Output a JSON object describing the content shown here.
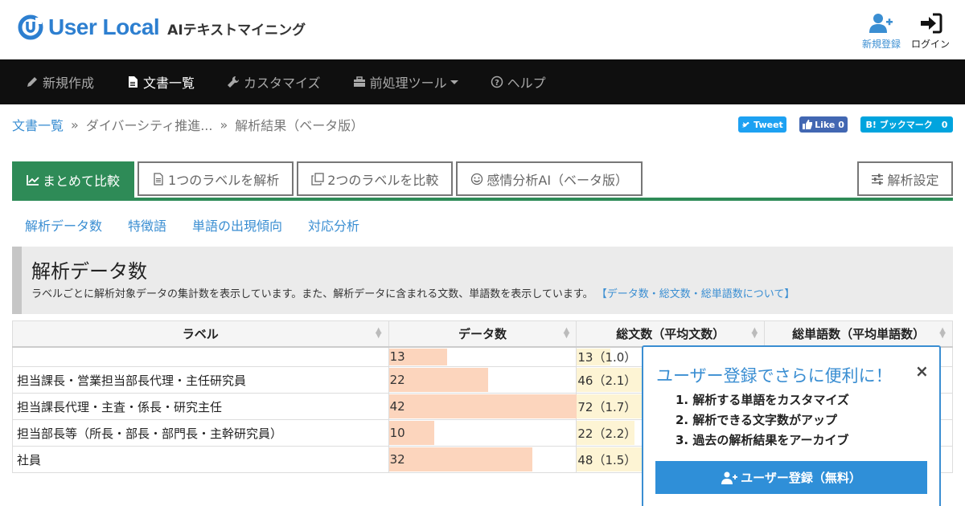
{
  "header": {
    "logo_text": "User Local",
    "logo_sub": "AIテキストマイニング",
    "register_label": "新規登録",
    "login_label": "ログイン",
    "brand_color": "#2d7fd0"
  },
  "nav": {
    "items": [
      {
        "label": "新規作成",
        "icon": "pencil-icon"
      },
      {
        "label": "文書一覧",
        "icon": "document-icon"
      },
      {
        "label": "カスタマイズ",
        "icon": "wrench-icon"
      },
      {
        "label": "前処理ツール",
        "icon": "toolbox-icon"
      },
      {
        "label": "ヘルプ",
        "icon": "question-circle-icon"
      }
    ],
    "active_index": 1
  },
  "breadcrumb": {
    "items": [
      "文書一覧",
      "ダイバーシティ推進...",
      "解析結果（ベータ版）"
    ],
    "sep": "»"
  },
  "social": {
    "tweet": "Tweet",
    "like": "Like 0",
    "hatena": "B! ブックマーク　0"
  },
  "tabs": {
    "items": [
      {
        "label": "まとめて比較",
        "icon": "chart-line-icon"
      },
      {
        "label": "1つのラベルを解析",
        "icon": "file-icon"
      },
      {
        "label": "2つのラベルを比較",
        "icon": "copy-icon"
      },
      {
        "label": "感情分析AI（ベータ版）",
        "icon": "smile-icon"
      }
    ],
    "active_index": 0,
    "settings_label": "解析設定",
    "accent": "#2e8b57"
  },
  "subtabs": [
    "解析データ数",
    "特徴語",
    "単語の出現傾向",
    "対応分析"
  ],
  "section": {
    "title": "解析データ数",
    "desc": "ラベルごとに解析対象データの集計数を表示しています。また、解析データに含まれる文数、単語数を表示しています。",
    "link": "【データ数・総文数・総単語数について】"
  },
  "table": {
    "headers": [
      "ラベル",
      "データ数",
      "総文数（平均文数）",
      "総単語数（平均単語数）"
    ],
    "rows": [
      {
        "label": "",
        "data": "13",
        "data_v": 13,
        "sent": "13（1.0）",
        "sent_v": 13
      },
      {
        "label": "担当課長・営業担当部長代理・主任研究員",
        "data": "22",
        "data_v": 22,
        "sent": "46（2.1）",
        "sent_v": 46
      },
      {
        "label": "担当課長代理・主査・係長・研究主任",
        "data": "42",
        "data_v": 42,
        "sent": "72（1.7）",
        "sent_v": 72
      },
      {
        "label": "担当部長等（所長・部長・部門長・主幹研究員）",
        "data": "10",
        "data_v": 10,
        "sent": "22（2.2）",
        "sent_v": 22
      },
      {
        "label": "社員",
        "data": "32",
        "data_v": 32,
        "sent": "48（1.5）",
        "sent_v": 48
      }
    ]
  },
  "popup": {
    "title": "ユーザー登録でさらに便利に！",
    "close": "×",
    "items": [
      "1. 解析する単語をカスタマイズ",
      "2. 解析できる文字数がアップ",
      "3. 過去の解析結果をアーカイブ"
    ],
    "button": "ユーザー登録（無料）",
    "color": "#3a8ed2"
  }
}
